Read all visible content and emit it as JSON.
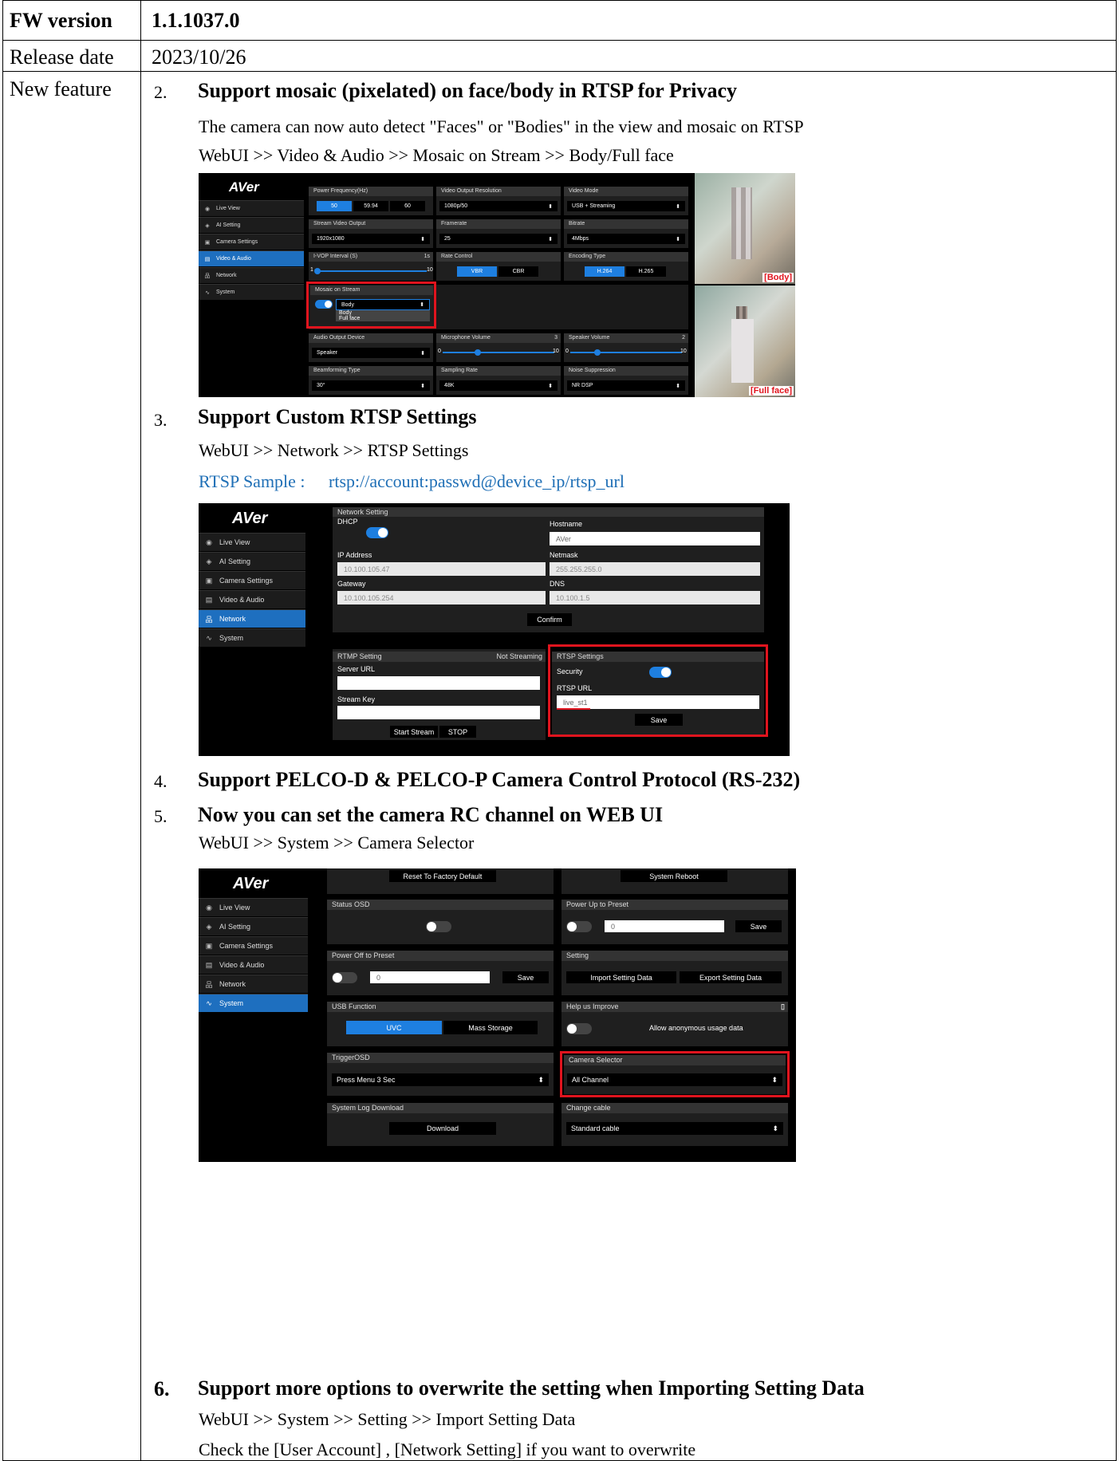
{
  "header": {
    "fw_label": "FW version",
    "fw_value": "1.1.1037.0",
    "date_label": "Release date",
    "date_value": "2023/10/26",
    "feature_label": "New feature"
  },
  "items": [
    {
      "num": "2.",
      "title": "Support mosaic (pixelated) on face/body in RTSP for Privacy",
      "lines": [
        "The camera can now auto detect \"Faces\" or \"Bodies\" in the view and mosaic on RTSP",
        "WebUI >> Video & Audio >> Mosaic on Stream >> Body/Full face"
      ]
    },
    {
      "num": "3.",
      "title": "Support Custom RTSP Settings",
      "lines": [
        "WebUI >> Network >> RTSP Settings"
      ],
      "sample_label": "RTSP Sample :",
      "sample_url": "rtsp://account:passwd@device_ip/rtsp_url"
    },
    {
      "num": "4.",
      "title": "Support PELCO-D & PELCO-P Camera Control Protocol (RS-232)"
    },
    {
      "num": "5.",
      "title": "Now you can set the camera RC channel on WEB UI",
      "lines": [
        "WebUI >> System >> Camera Selector"
      ]
    },
    {
      "num": "6.",
      "title": "Support more options to overwrite the setting when Importing Setting Data",
      "lines": [
        "WebUI >> System >> Setting >> Import Setting Data",
        "Check the [User Account] , [Network Setting] if you want to overwrite"
      ]
    }
  ],
  "nav": {
    "logo": "AVer",
    "live_view": "Live View",
    "ai_setting": "AI Setting",
    "camera_settings": "Camera Settings",
    "video_audio": "Video & Audio",
    "network": "Network",
    "system": "System"
  },
  "shot1": {
    "power_freq": {
      "title": "Power Frequency(Hz)",
      "opts": [
        "50",
        "59.94",
        "60"
      ]
    },
    "vo_res": {
      "title": "Video Output Resolution",
      "value": "1080p/50"
    },
    "video_mode": {
      "title": "Video Mode",
      "value": "USB + Streaming"
    },
    "stream_out": {
      "title": "Stream Video Output",
      "value": "1920x1080"
    },
    "framerate": {
      "title": "Framerate",
      "value": "25"
    },
    "bitrate": {
      "title": "Bitrate",
      "value": "4Mbps"
    },
    "ivop": {
      "title": "I-VOP Interval (S)",
      "value": "1s",
      "min": "1",
      "max": "10"
    },
    "rate": {
      "title": "Rate Control",
      "opts": [
        "VBR",
        "CBR"
      ]
    },
    "enc": {
      "title": "Encoding Type",
      "opts": [
        "H.264",
        "H.265"
      ]
    },
    "mosaic": {
      "title": "Mosaic on Stream",
      "value": "Body",
      "opts": [
        "Body",
        "Full face"
      ]
    },
    "audio_out": {
      "title": "Audio Output Device",
      "value": "Speaker"
    },
    "mic": {
      "title": "Microphone Volume",
      "value": "3",
      "min": "0",
      "max": "10"
    },
    "spk": {
      "title": "Speaker Volume",
      "value": "2",
      "min": "0",
      "max": "10"
    },
    "beam": {
      "title": "Beamforming Type",
      "value": "30°"
    },
    "samp": {
      "title": "Sampling Rate",
      "value": "48K"
    },
    "noise": {
      "title": "Noise Suppression",
      "value": "NR DSP"
    },
    "tag_body": "[Body]",
    "tag_face": "[Full face]"
  },
  "shot2": {
    "net_title": "Network Setting",
    "dhcp": "DHCP",
    "hostname": "Hostname",
    "hostname_val": "AVer",
    "ip": "IP Address",
    "ip_val": "10.100.105.47",
    "netmask": "Netmask",
    "netmask_val": "255.255.255.0",
    "gateway": "Gateway",
    "gateway_val": "10.100.105.254",
    "dns": "DNS",
    "dns_val": "10.100.1.5",
    "confirm": "Confirm",
    "rtmp": "RTMP Setting",
    "not_streaming": "Not Streaming",
    "server_url": "Server URL",
    "stream_key": "Stream Key",
    "start": "Start Stream",
    "stop": "STOP",
    "rtsp": "RTSP Settings",
    "security": "Security",
    "rtsp_url": "RTSP URL",
    "rtsp_val": "live_st1",
    "save": "Save"
  },
  "shot3": {
    "reset": "Reset To Factory Default",
    "reboot": "System Reboot",
    "status_osd": "Status OSD",
    "power_up": "Power Up to Preset",
    "pu_val": "0",
    "save": "Save",
    "power_off": "Power Off to Preset",
    "po_val": "0",
    "setting": "Setting",
    "import": "Import Setting Data",
    "export": "Export Setting Data",
    "usb": "USB Function",
    "uvc": "UVC",
    "mass": "Mass Storage",
    "help": "Help us Improve",
    "allow": "Allow anonymous usage data",
    "trigger": "TriggerOSD",
    "trigger_val": "Press Menu 3 Sec",
    "cam_sel": "Camera Selector",
    "cam_val": "All Channel",
    "log": "System Log Download",
    "download": "Download",
    "cable": "Change cable",
    "cable_val": "Standard cable"
  }
}
